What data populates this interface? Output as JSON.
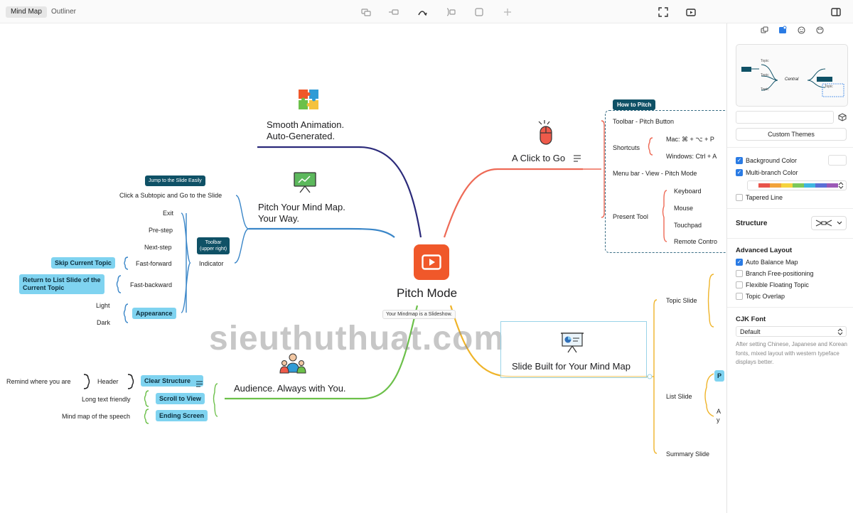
{
  "toolbar": {
    "tabs": [
      "Mind Map",
      "Outliner"
    ],
    "icons": [
      "topic-icon",
      "subtopic-icon",
      "relationship-icon",
      "boundary-icon",
      "summary-icon",
      "insert-icon",
      "fullscreen-icon",
      "pitch-icon",
      "sidebar-toggle-icon"
    ]
  },
  "central": {
    "title": "Pitch Mode",
    "caption": "Your Mindmap is a Slideshow."
  },
  "branches": {
    "smooth": {
      "line1": "Smooth Animation.",
      "line2": "Auto-Generated."
    },
    "pitch": {
      "line1": "Pitch Your Mind Map.",
      "line2": "Your Way.",
      "callout": "Jump to the Slide Easily",
      "subtopic": "Click a Subtopic and Go to the Slide",
      "indicator": "Indicator",
      "toolbar_callout_1": "Toolbar",
      "toolbar_callout_2": "(upper right)",
      "items": [
        "Exit",
        "Pre-step",
        "Next-step",
        "Fast-forward",
        "Fast-backward",
        "Light",
        "Dark"
      ],
      "pills": [
        "Skip Current Topic",
        "Return to List Slide of the",
        "Current Topic",
        "Appearance"
      ]
    },
    "click": {
      "title": "A Click to Go",
      "badge": "How to Pitch",
      "toolbar": "Toolbar - Pitch Button",
      "shortcuts": "Shortcuts",
      "mac": "Mac: ⌘ + ⌥ + P",
      "windows": "Windows: Ctrl + A",
      "menubar": "Menu bar - View - Pitch Mode",
      "present": "Present Tool",
      "tools": [
        "Keyboard",
        "Mouse",
        "Touchpad",
        "Remote Contro"
      ]
    },
    "audience": {
      "title": "Audience. Always with You.",
      "remind": "Remind where you are",
      "header": "Header",
      "long": "Long text friendly",
      "mindmap": "Mind map of the speech",
      "pills": [
        "Clear Structure",
        "Scroll to View",
        "Ending Screen"
      ]
    },
    "slide": {
      "title": "Slide Built for Your Mind Map",
      "topic": "Topic Slide",
      "list": "List Slide",
      "summary": "Summary Slide",
      "clip1": "P",
      "clip2": "A",
      "clip3": "y"
    }
  },
  "watermark": "sieuthuthuat.com",
  "sidebar": {
    "preview_labels": [
      "Topic",
      "Topic",
      "Topic",
      "Central",
      "Topic"
    ],
    "custom_themes": "Custom Themes",
    "background_color": "Background Color",
    "multi_branch": "Multi-branch Color",
    "tapered": "Tapered Line",
    "structure": "Structure",
    "advanced": "Advanced Layout",
    "auto_balance": "Auto Balance Map",
    "branch_free": "Branch Free-positioning",
    "flexible": "Flexible Floating Topic",
    "overlap": "Topic Overlap",
    "cjk": "CJK Font",
    "font_default": "Default",
    "note": "After setting Chinese, Japanese and Korean fonts, mixed layout with western typeface displays better.",
    "branch_colors": [
      "#e8534a",
      "#f2a33a",
      "#f5d33d",
      "#7cc85a",
      "#3fb6e0",
      "#5a6fd6",
      "#9b59b6"
    ]
  },
  "colors": {
    "accent": "#f0582a",
    "navy": "#2b2a7a",
    "blue": "#3a86c8",
    "salmon": "#ee6a56",
    "green": "#6cc04a",
    "gold": "#efb42a",
    "pill": "#7fd3f0",
    "badge": "#0f5166"
  }
}
